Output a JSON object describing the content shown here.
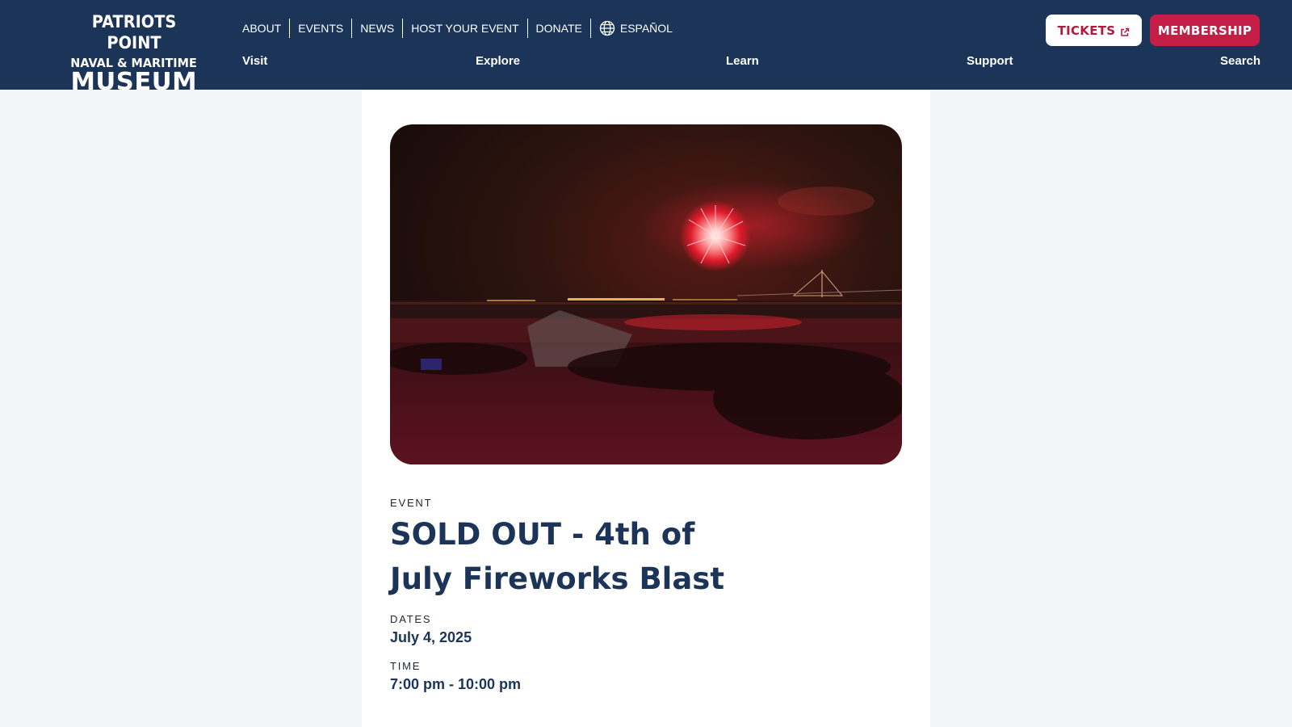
{
  "header": {
    "logo": {
      "line1": "PATRIOTS POINT",
      "line2": "NAVAL & MARITIME",
      "line3": "MUSEUM"
    },
    "utility_nav": [
      "ABOUT",
      "EVENTS",
      "NEWS",
      "HOST YOUR EVENT",
      "DONATE"
    ],
    "language_label": "ESPAÑOL",
    "main_nav": [
      "Visit",
      "Explore",
      "Learn",
      "Support",
      "Search"
    ],
    "tickets_label": "TICKETS",
    "membership_label": "MEMBERSHIP"
  },
  "colors": {
    "header_bg": "#1b3458",
    "accent_red": "#c41e46",
    "title_navy": "#1b3458",
    "page_bg": "#f3f5f8"
  },
  "icons": {
    "language": "globe-icon",
    "tickets": "external-link-icon"
  },
  "event": {
    "category": "EVENT",
    "title": "SOLD OUT - 4th of July Fireworks Blast",
    "dates_label": "DATES",
    "dates_value": "July 4, 2025",
    "time_label": "TIME",
    "time_value": "7:00 pm - 10:00 pm"
  }
}
